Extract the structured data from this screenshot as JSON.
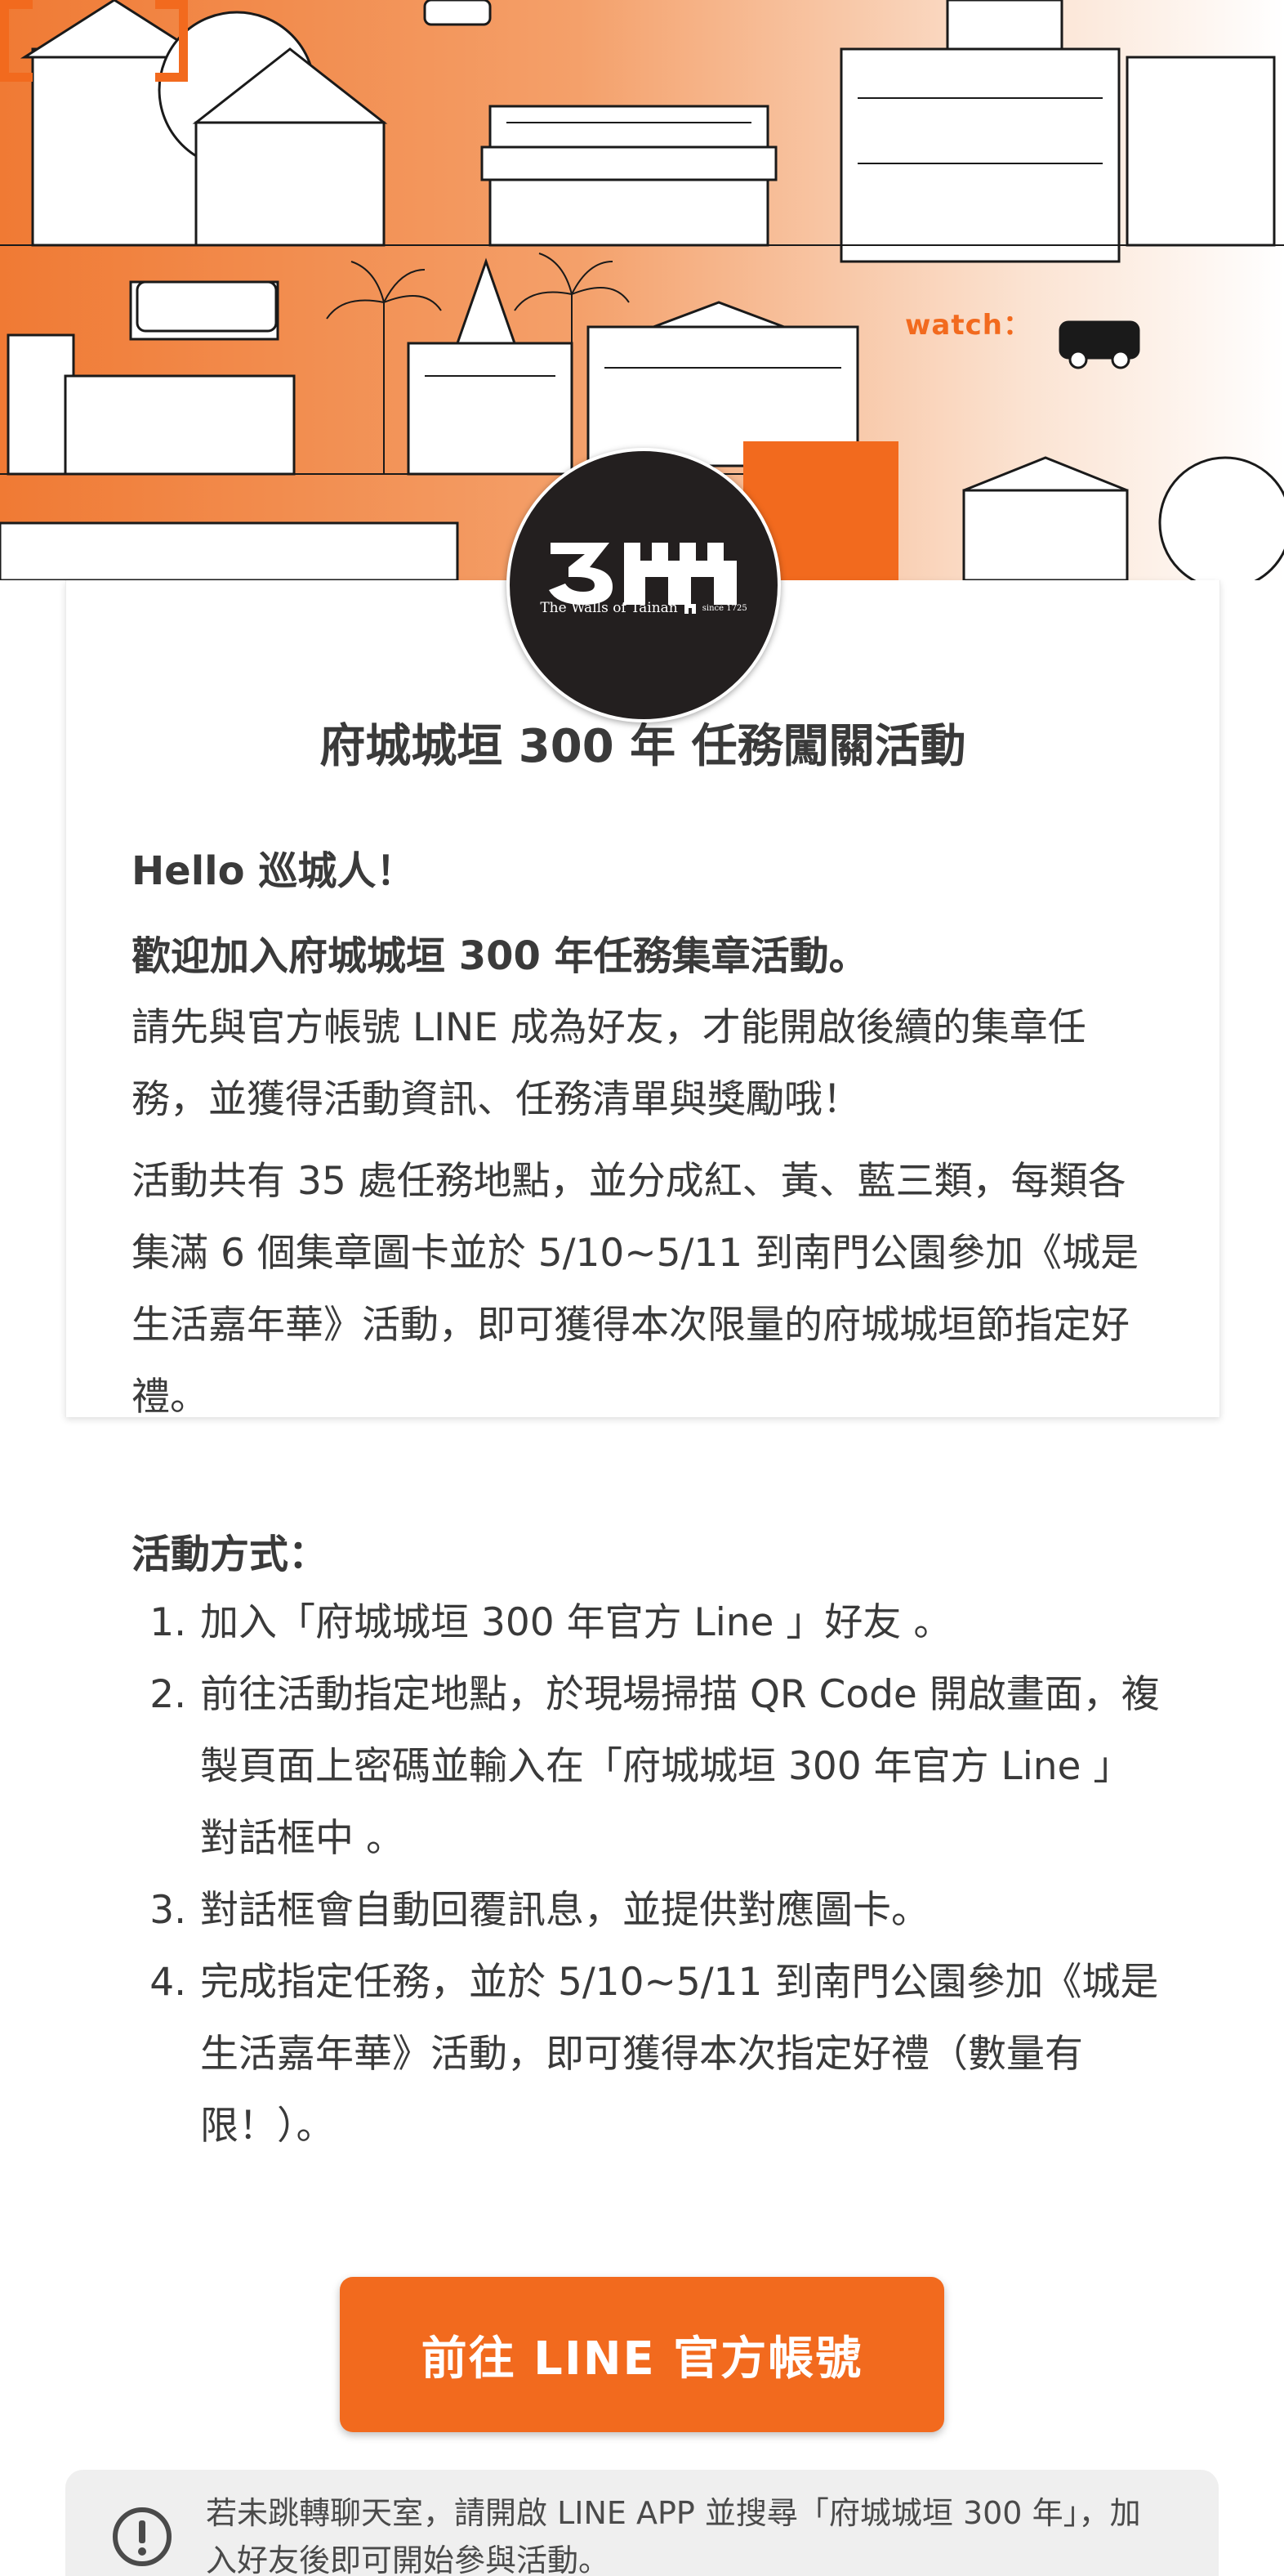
{
  "banner": {
    "watch_label": "watch：",
    "accent_color": "#f26a1e"
  },
  "logo": {
    "mark": "300",
    "name": "The Walls of Tainan",
    "since": "since 1725"
  },
  "card": {
    "title": "府城城垣 300 年 任務闖關活動",
    "hello": "Hello 巡城人！",
    "welcome": "歡迎加入府城城垣 300 年任務集章活動。",
    "paragraph1": "請先與官方帳號 LINE 成為好友，才能開啟後續的集章任務，並獲得活動資訊、任務清單與獎勵哦！",
    "paragraph2": "活動共有 35 處任務地點，並分成紅、黃、藍三類，每類各集滿 6 個集章圖卡並於 5/10~5/11 到南門公園參加《城是生活嘉年華》活動，即可獲得本次限量的府城城垣節指定好禮。",
    "method_title": "活動方式：",
    "steps": [
      "加入「府城城垣 300 年官方 Line 」好友 。",
      "前往活動指定地點，於現場掃描 QR Code 開啟畫面，複製頁面上密碼並輸入在「府城城垣 300 年官方 Line 」對話框中 。",
      "對話框會自動回覆訊息，並提供對應圖卡。",
      "完成指定任務，並於 5/10~5/11 到南門公園參加《城是生活嘉年華》活動，即可獲得本次指定好禮（數量有限！）。"
    ]
  },
  "cta": {
    "label": "前往 LINE 官方帳號",
    "color": "#f26a1e"
  },
  "notice": {
    "icon": "alert-circle-icon",
    "text": "若未跳轉聊天室，請開啟 LINE APP 並搜尋「府城城垣 300 年」，加入好友後即可開始參與活動。"
  }
}
